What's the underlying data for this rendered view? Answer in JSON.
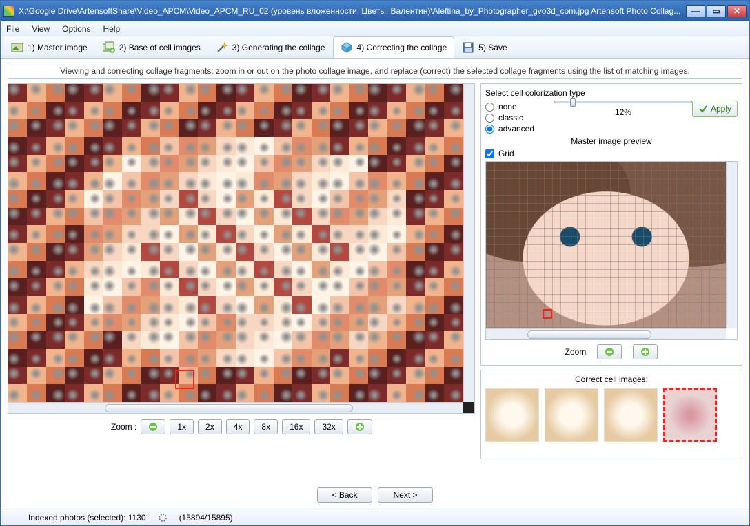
{
  "window": {
    "title": "X:\\Google Drive\\ArtensoftShare\\Video_APCM\\Video_APCM_RU_02 (уровень вложенности, Цветы, Валентин)\\Aleftina_by_Photographer_gvo3d_com.jpg Artensoft Photo Collag..."
  },
  "menu": {
    "file": "File",
    "view": "View",
    "options": "Options",
    "help": "Help"
  },
  "steps": {
    "s1": "1) Master image",
    "s2": "2) Base of cell images",
    "s3": "3) Generating the collage",
    "s4": "4) Correcting the collage",
    "s5": "5) Save"
  },
  "instruction": "Viewing and correcting collage fragments: zoom in or out on the photo collage image, and replace (correct) the selected collage fragments using the list of matching images.",
  "zoom": {
    "label": "Zoom   :",
    "b1": "1x",
    "b2": "2x",
    "b4": "4x",
    "b8": "8x",
    "b16": "16x",
    "b32": "32x"
  },
  "colorize": {
    "header": "Select cell colorization type",
    "none": "none",
    "classic": "classic",
    "advanced": "advanced",
    "percent": "12%",
    "apply": "Apply"
  },
  "preview": {
    "title": "Master image preview",
    "grid": "Grid",
    "zoom": "Zoom"
  },
  "correct": {
    "header": "Correct cell images:"
  },
  "nav": {
    "back": "< Back",
    "next": "Next >"
  },
  "status": {
    "indexed": "Indexed photos (selected): 1130",
    "progress": "(15894/15895)"
  }
}
